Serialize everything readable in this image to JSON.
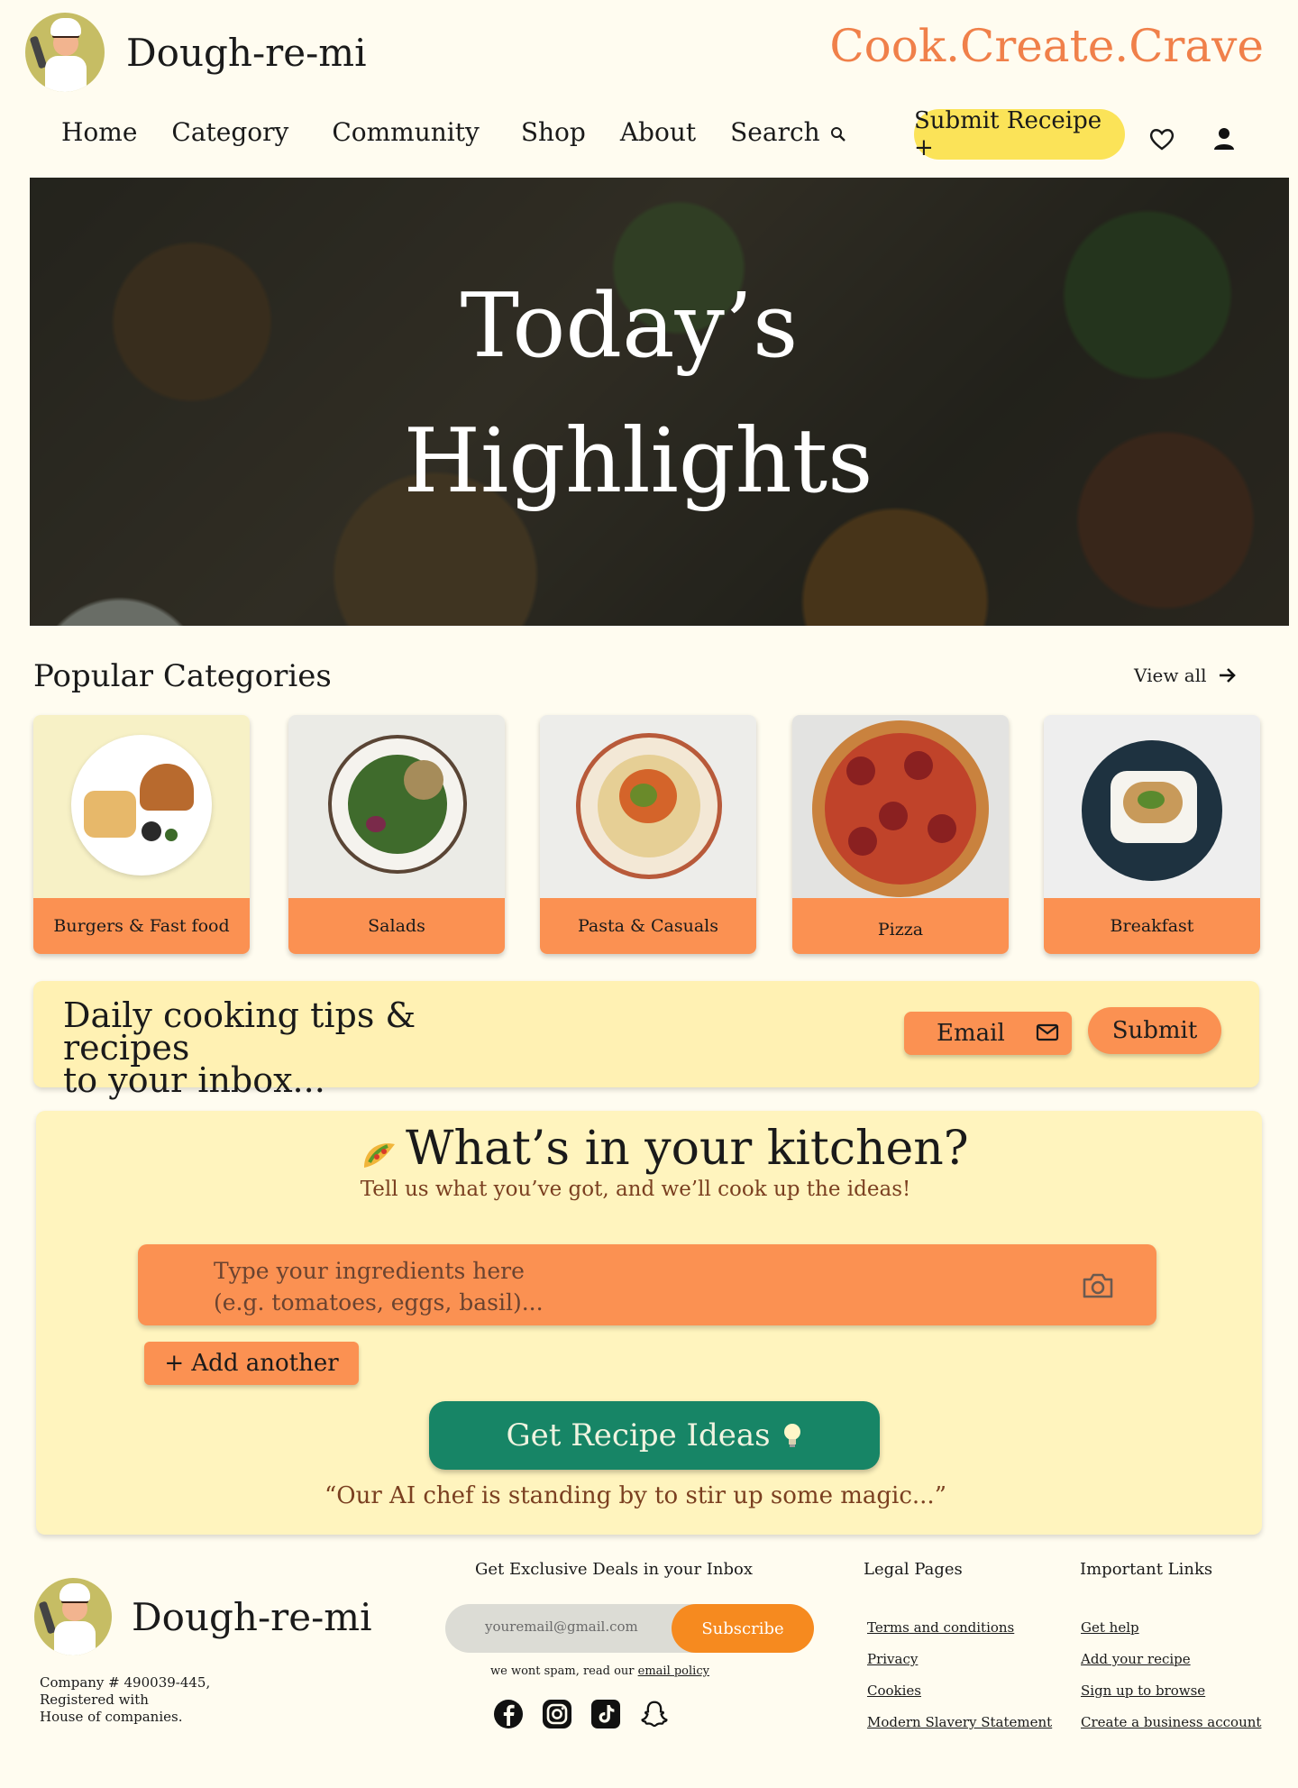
{
  "brand": {
    "name": "Dough-re-mi",
    "tagline": "Cook.Create.Crave"
  },
  "nav": {
    "items": [
      "Home",
      "Category",
      "Community",
      "Shop",
      "About",
      "Search"
    ],
    "submit_label": "Submit Receipe +"
  },
  "hero": {
    "line1": "Today’s",
    "line2": "Highlights"
  },
  "categories": {
    "title": "Popular Categories",
    "view_all": "View all",
    "items": [
      {
        "label": "Burgers & Fast food"
      },
      {
        "label": "Salads"
      },
      {
        "label": "Pasta & Casuals"
      },
      {
        "label": "Pizza"
      },
      {
        "label": "Breakfast"
      }
    ]
  },
  "newsletter": {
    "line1": "Daily cooking tips & recipes",
    "line2": "to your inbox...",
    "email_label": "Email",
    "submit_label": "Submit"
  },
  "kitchen": {
    "title": "What’s in your kitchen?",
    "subtitle": "Tell us what you’ve got, and we’ll cook up the ideas!",
    "placeholder_line1": "Type your ingredients here",
    "placeholder_line2": "(e.g. tomatoes, eggs, basil)...",
    "add_another": "+ Add another",
    "get_recipe": "Get Recipe Ideas",
    "quote": "“Our AI chef is standing by to stir up some magic...”"
  },
  "footer": {
    "brand": "Dough-re-mi",
    "company_line1": "Company # 490039-445,",
    "company_line2": "Registered with",
    "company_line3": "House of companies.",
    "deals_title": "Get Exclusive Deals in your Inbox",
    "email_placeholder": "youremail@gmail.com",
    "subscribe": "Subscribe",
    "spam_text": "we wont spam, read our",
    "spam_link": "email policy",
    "legal_title": "Legal Pages",
    "legal_links": [
      "Terms and conditions",
      "Privacy",
      "Cookies",
      "Modern Slavery Statement"
    ],
    "important_title": "Important Links",
    "important_links": [
      "Get help",
      "Add your recipe",
      "Sign up to browse",
      "Create a business account"
    ],
    "socials": [
      "facebook-icon",
      "instagram-icon",
      "tiktok-icon",
      "snapchat-icon"
    ]
  },
  "colors": {
    "background": "#fffcf0",
    "accent_orange": "#fb9152",
    "tagline_orange": "#f0804a",
    "submit_yellow": "#fbe358",
    "green_button": "#178566",
    "panel_yellow": "#fff4be",
    "subscribe_orange": "#f68a1f"
  }
}
